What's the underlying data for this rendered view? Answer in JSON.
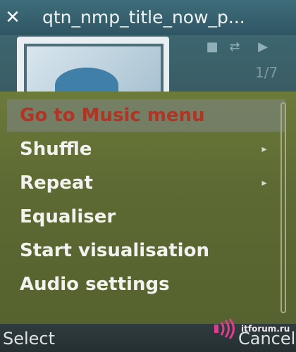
{
  "titlebar": {
    "title": "qtn_nmp_title_now_p...",
    "close_icon": "close-icon"
  },
  "player": {
    "track_count": "1/7",
    "icons": [
      "stop-icon",
      "shuffle-icon",
      "play-icon"
    ]
  },
  "menu": {
    "items": [
      {
        "label": "Go to Music menu",
        "submenu": false,
        "selected": true
      },
      {
        "label": "Shuffle",
        "submenu": true
      },
      {
        "label": "Repeat",
        "submenu": true
      },
      {
        "label": "Equaliser",
        "submenu": false
      },
      {
        "label": "Start visualisation",
        "submenu": false
      },
      {
        "label": "Audio settings",
        "submenu": false
      }
    ]
  },
  "softkeys": {
    "left": "Select",
    "right": "Cancel"
  },
  "watermark": {
    "text": "itforum.ru"
  },
  "colors": {
    "menu_background": "#5d6a33",
    "highlight_text": "#b13425",
    "title_background": "#3f6d7b"
  }
}
